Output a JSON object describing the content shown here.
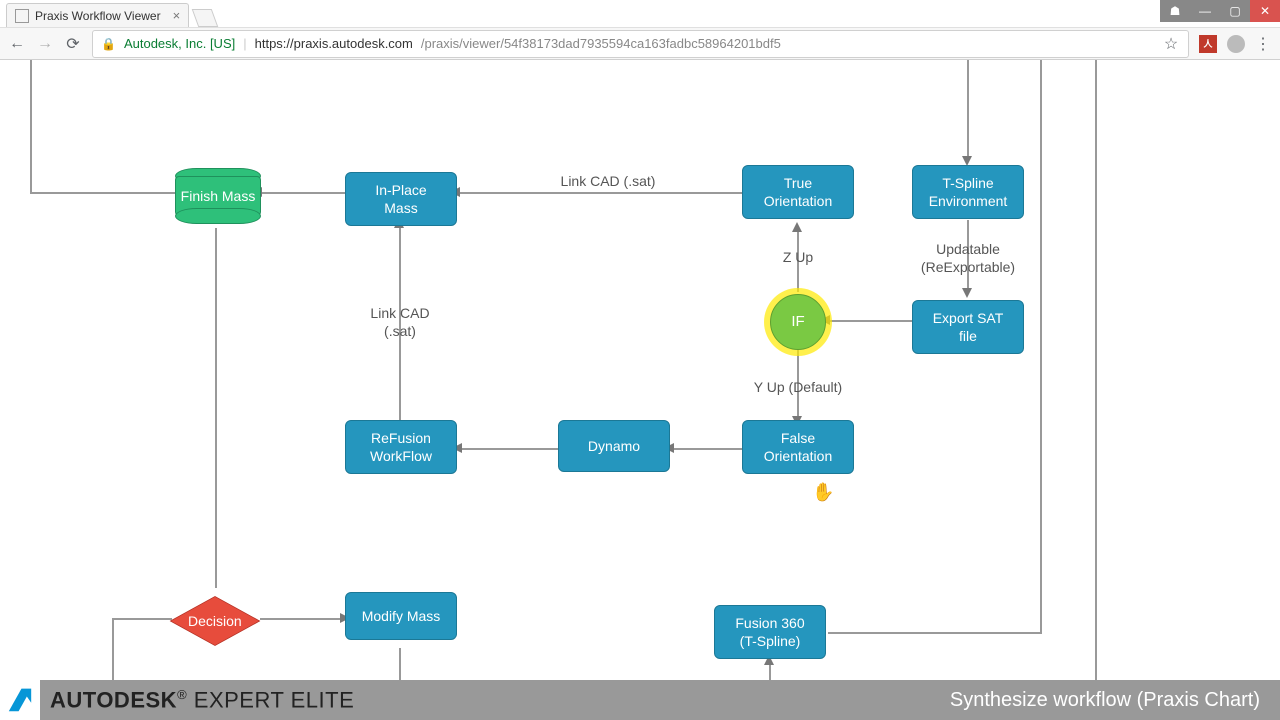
{
  "browser": {
    "tab_title": "Praxis Workflow Viewer",
    "secure_label": "Autodesk, Inc. [US]",
    "url_host": "https://praxis.autodesk.com",
    "url_path": "/praxis/viewer/54f38173dad7935594ca163fadbc58964201bdf5"
  },
  "nodes": {
    "finish_mass": "Finish Mass",
    "in_place_mass": "In-Place Mass",
    "true_orientation": "True Orientation",
    "tspline_env": "T-Spline Environment",
    "if": "IF",
    "export_sat": "Export SAT file",
    "false_orientation": "False Orientation",
    "dynamo": "Dynamo",
    "refusion": "ReFusion WorkFlow",
    "decision": "Decision",
    "modify_mass": "Modify Mass",
    "fusion360": "Fusion 360 (T-Spline)"
  },
  "labels": {
    "link_cad1": "Link CAD (.sat)",
    "z_up": "Z Up",
    "updatable": "Updatable (ReExportable)",
    "y_up": "Y Up (Default)",
    "link_cad2": "Link CAD (.sat)"
  },
  "footer": {
    "brand1": "AUTODESK",
    "brand2": "EXPERT ELITE",
    "tagline": "Synthesize workflow (Praxis Chart)"
  }
}
